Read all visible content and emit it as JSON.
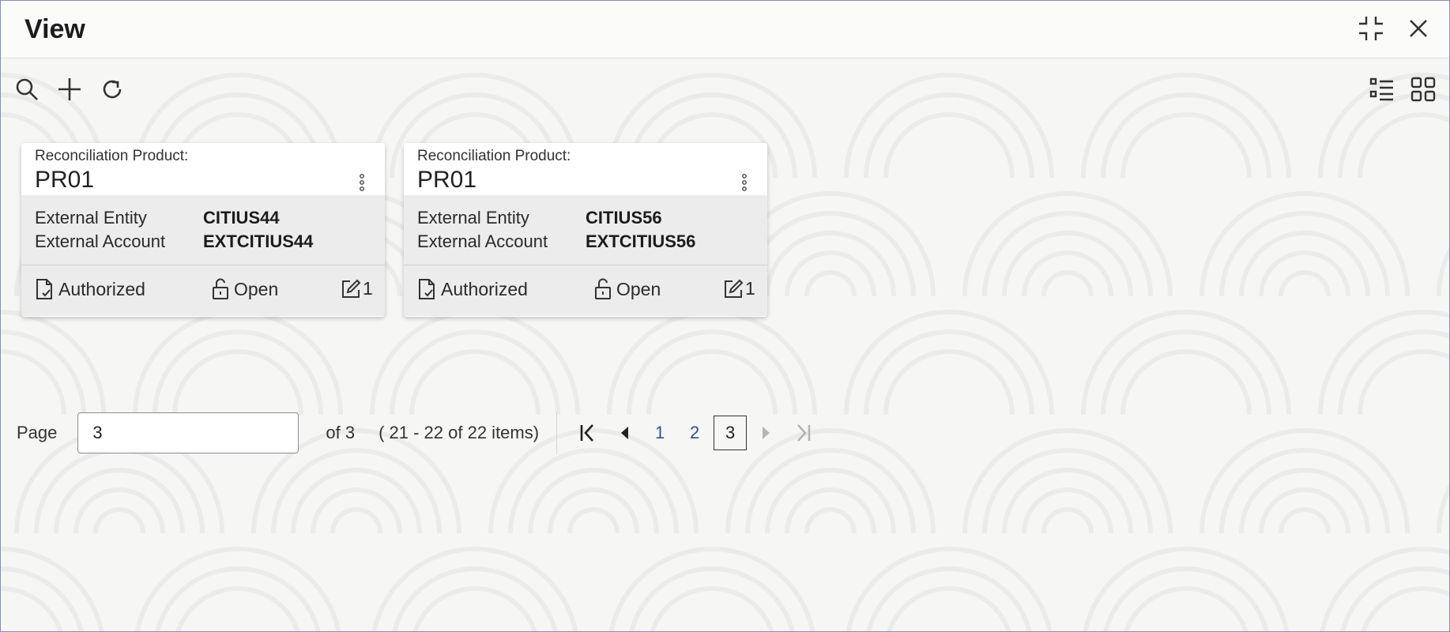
{
  "header": {
    "title": "View"
  },
  "toolbar": {
    "left_icons": [
      "search-icon",
      "add-icon",
      "refresh-icon"
    ],
    "right_icons": [
      "list-view-icon",
      "grid-view-icon"
    ]
  },
  "cards": [
    {
      "label": "Reconciliation Product:",
      "value": "PR01",
      "fields": [
        {
          "key": "External Entity",
          "value": "CITIUS44"
        },
        {
          "key": "External Account",
          "value": "EXTCITIUS44"
        }
      ],
      "status": "Authorized",
      "lock": "Open",
      "edits": "1"
    },
    {
      "label": "Reconciliation Product:",
      "value": "PR01",
      "fields": [
        {
          "key": "External Entity",
          "value": "CITIUS56"
        },
        {
          "key": "External Account",
          "value": "EXTCITIUS56"
        }
      ],
      "status": "Authorized",
      "lock": "Open",
      "edits": "1"
    }
  ],
  "pagination": {
    "label": "Page",
    "current": "3",
    "of_text": "of 3",
    "items_text": "( 21 - 22 of 22 items)",
    "pages": [
      "1",
      "2",
      "3"
    ]
  },
  "colors": {
    "link": "#3a4f8a",
    "card_body": "#ececec",
    "background": "#f6f6f5"
  }
}
